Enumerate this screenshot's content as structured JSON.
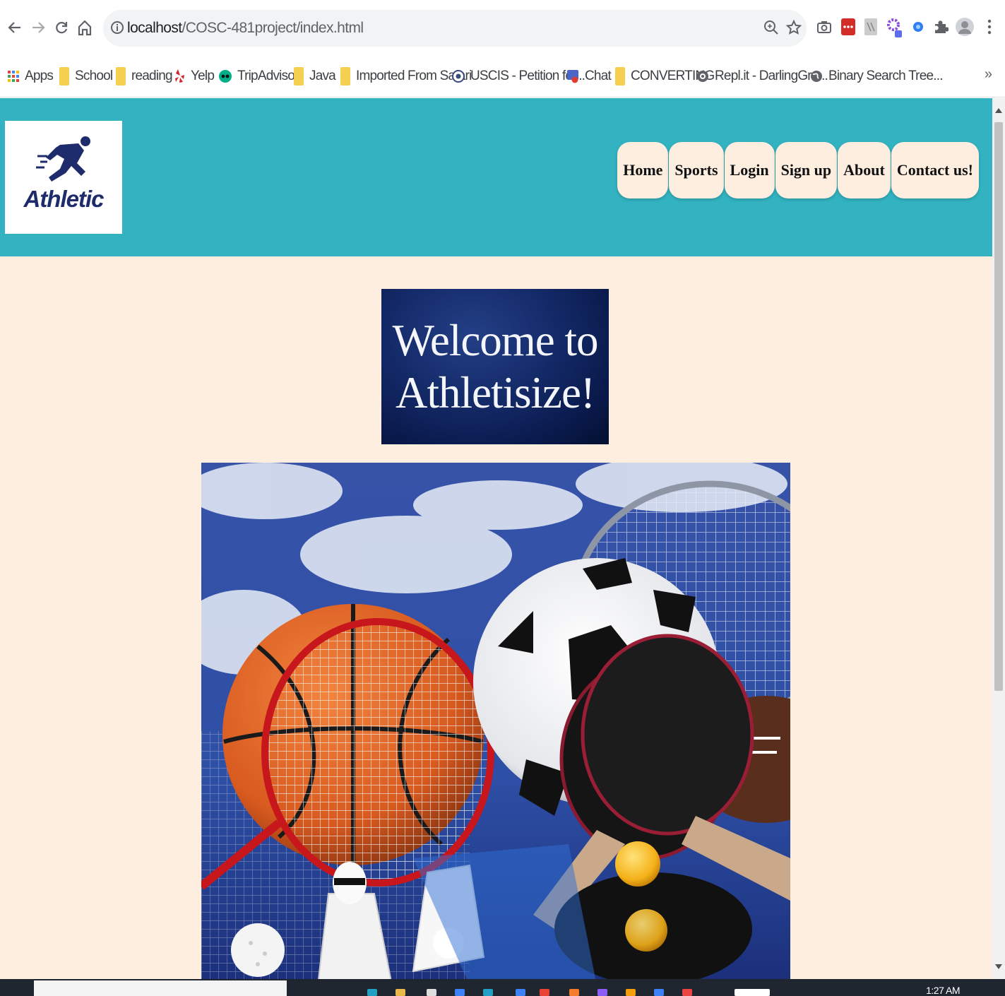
{
  "browser": {
    "url_host": "localhost",
    "url_path": "/COSC-481project/index.html",
    "bookmarks": [
      {
        "label": "Apps",
        "icon": "apps-grid-icon"
      },
      {
        "label": "School",
        "icon": "folder-icon"
      },
      {
        "label": "reading",
        "icon": "folder-icon"
      },
      {
        "label": "Yelp",
        "icon": "yelp-icon"
      },
      {
        "label": "TripAdvisor",
        "icon": "tripadvisor-icon"
      },
      {
        "label": "Java",
        "icon": "folder-icon"
      },
      {
        "label": "Imported From Safari",
        "icon": "folder-icon"
      },
      {
        "label": "USCIS - Petition for...",
        "icon": "uscis-seal-icon"
      },
      {
        "label": "Chat",
        "icon": "chat-icon"
      },
      {
        "label": "CONVERTING",
        "icon": "folder-icon"
      },
      {
        "label": "Repl.it - DarlingGro...",
        "icon": "replit-icon"
      },
      {
        "label": "Binary Search Tree...",
        "icon": "globe-icon"
      }
    ],
    "more_bookmarks": "»"
  },
  "site": {
    "logo_text": "Athletic",
    "nav": [
      "Home",
      "Sports",
      "Login",
      "Sign up",
      "About",
      "Contact us!"
    ],
    "welcome_line1": "Welcome to",
    "welcome_line2": "Athletisize!",
    "hero_image": "sports-equipment-collage"
  },
  "taskbar": {
    "clock": "1:27 AM"
  },
  "colors": {
    "header_bg": "#33b3c1",
    "page_bg": "#fdeee0",
    "logo_navy": "#1f2c6b",
    "welcome_bg": "#0a1a4d"
  }
}
